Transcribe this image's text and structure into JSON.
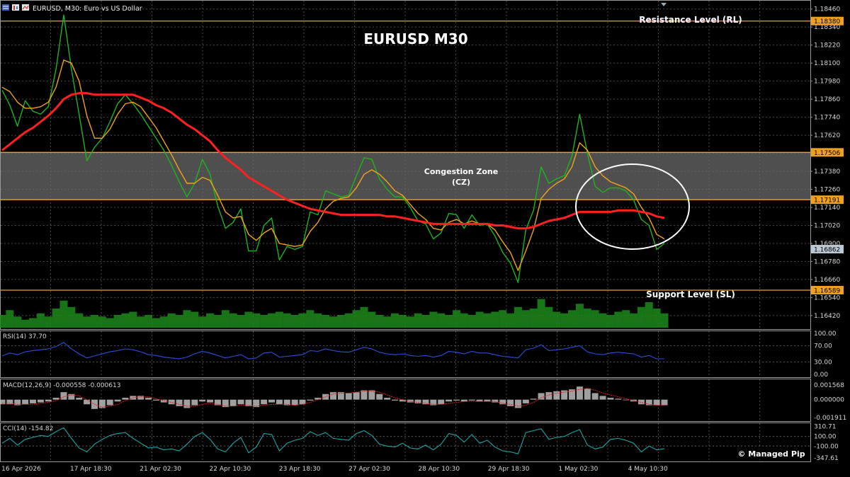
{
  "window": {
    "symbol_title": "EURUSD, M30:  Euro vs US Dollar",
    "watermark": "© Managed Pip"
  },
  "chart_data": [
    {
      "type": "line",
      "panel": "price",
      "title": "EURUSD M30",
      "ylim": [
        1.1633,
        1.1852
      ],
      "y_ticks": [
        "1.18460",
        "1.18340",
        "1.18220",
        "1.18100",
        "1.17980",
        "1.17860",
        "1.17740",
        "1.17620",
        "1.17500",
        "1.17380",
        "1.17260",
        "1.17140",
        "1.17020",
        "1.16900",
        "1.16780",
        "1.16660",
        "1.16540",
        "1.16420"
      ],
      "x_ticks": [
        "16 Apr 2026",
        "17 Apr 18:30",
        "21 Apr 02:30",
        "22 Apr 10:30",
        "23 Apr 18:30",
        "27 Apr 02:30",
        "28 Apr 10:30",
        "29 Apr 18:30",
        "1 May 02:30",
        "4 May 10:30"
      ],
      "levels": [
        {
          "label": "Resistance Level (RL)",
          "value": 1.1838,
          "tag": "1.18380"
        },
        {
          "label": "Support Level (SL)",
          "value": 1.16589,
          "tag": "1.16589"
        }
      ],
      "zone": {
        "label": "Congestion Zone\n(CZ)",
        "top": 1.17506,
        "bottom": 1.17191,
        "top_tag": "1.17506",
        "bottom_tag": "1.17191"
      },
      "current_price": {
        "value": 1.16862,
        "tag": "1.16862"
      },
      "series": [
        {
          "role": "price",
          "color": "#1db51d",
          "values": [
            1.1792,
            1.1782,
            1.1768,
            1.1785,
            1.1778,
            1.1776,
            1.1781,
            1.1806,
            1.1842,
            1.1806,
            1.1776,
            1.1745,
            1.1754,
            1.176,
            1.1771,
            1.1783,
            1.1789,
            1.1783,
            1.1776,
            1.1768,
            1.176,
            1.1752,
            1.1742,
            1.1731,
            1.1721,
            1.173,
            1.1746,
            1.1736,
            1.1715,
            1.17,
            1.1704,
            1.1713,
            1.1685,
            1.1685,
            1.1702,
            1.1707,
            1.1679,
            1.1688,
            1.1686,
            1.1688,
            1.1711,
            1.1709,
            1.1725,
            1.1723,
            1.1721,
            1.1722,
            1.1735,
            1.1747,
            1.1746,
            1.1733,
            1.1726,
            1.1721,
            1.1721,
            1.1714,
            1.1705,
            1.1703,
            1.1693,
            1.1697,
            1.171,
            1.1709,
            1.17,
            1.1709,
            1.1702,
            1.1703,
            1.1695,
            1.1684,
            1.1677,
            1.1664,
            1.1699,
            1.1712,
            1.1741,
            1.173,
            1.1733,
            1.1735,
            1.1748,
            1.1776,
            1.175,
            1.1728,
            1.1724,
            1.1727,
            1.1727,
            1.1725,
            1.1719,
            1.1706,
            1.1702,
            1.1686,
            1.169
          ]
        },
        {
          "role": "ma-fast",
          "color": "#f2a21a",
          "values": [
            1.1794,
            1.1791,
            1.1784,
            1.178,
            1.178,
            1.1781,
            1.1784,
            1.1794,
            1.1812,
            1.181,
            1.1798,
            1.1775,
            1.176,
            1.176,
            1.1766,
            1.1776,
            1.1783,
            1.1784,
            1.1781,
            1.1774,
            1.1767,
            1.1758,
            1.1749,
            1.1739,
            1.173,
            1.173,
            1.1734,
            1.1732,
            1.1722,
            1.1711,
            1.1707,
            1.1708,
            1.1696,
            1.1692,
            1.1697,
            1.17,
            1.169,
            1.1689,
            1.1688,
            1.1689,
            1.1698,
            1.1704,
            1.1713,
            1.1718,
            1.172,
            1.1721,
            1.1727,
            1.1736,
            1.1739,
            1.1736,
            1.1731,
            1.1725,
            1.1722,
            1.1716,
            1.171,
            1.1706,
            1.17,
            1.1699,
            1.1704,
            1.1706,
            1.1703,
            1.1705,
            1.1703,
            1.1703,
            1.1699,
            1.1691,
            1.1684,
            1.1672,
            1.1685,
            1.1699,
            1.172,
            1.1726,
            1.173,
            1.1733,
            1.1741,
            1.1757,
            1.1752,
            1.1741,
            1.1735,
            1.1731,
            1.1729,
            1.1727,
            1.1723,
            1.1714,
            1.1707,
            1.1696,
            1.1693
          ]
        },
        {
          "role": "ma-slow",
          "color": "#ff2020",
          "values": [
            1.1752,
            1.1756,
            1.176,
            1.1764,
            1.1767,
            1.1771,
            1.1775,
            1.178,
            1.1786,
            1.1789,
            1.179,
            1.179,
            1.1789,
            1.1789,
            1.1789,
            1.1789,
            1.1789,
            1.1789,
            1.1787,
            1.1785,
            1.1782,
            1.178,
            1.1777,
            1.1773,
            1.1769,
            1.1766,
            1.1762,
            1.1758,
            1.1752,
            1.1747,
            1.1743,
            1.1739,
            1.1734,
            1.1731,
            1.1728,
            1.1725,
            1.1722,
            1.1719,
            1.1717,
            1.1715,
            1.1713,
            1.1712,
            1.1711,
            1.171,
            1.1709,
            1.1709,
            1.1709,
            1.1709,
            1.1709,
            1.1709,
            1.1708,
            1.1708,
            1.1707,
            1.1706,
            1.1705,
            1.1704,
            1.1703,
            1.1703,
            1.1703,
            1.1703,
            1.1703,
            1.1703,
            1.1703,
            1.1703,
            1.1702,
            1.1702,
            1.1701,
            1.17,
            1.17,
            1.1701,
            1.1703,
            1.1705,
            1.1706,
            1.1707,
            1.1709,
            1.1711,
            1.1711,
            1.1711,
            1.1711,
            1.1711,
            1.1712,
            1.1712,
            1.1712,
            1.1711,
            1.171,
            1.1708,
            1.1707
          ]
        }
      ]
    },
    {
      "type": "bar",
      "panel": "volume",
      "color": "#1b8a1b",
      "values": [
        0.4,
        0.55,
        0.35,
        0.25,
        0.3,
        0.45,
        0.35,
        0.6,
        0.85,
        0.65,
        0.45,
        0.35,
        0.4,
        0.35,
        0.3,
        0.4,
        0.45,
        0.5,
        0.35,
        0.4,
        0.3,
        0.35,
        0.45,
        0.4,
        0.55,
        0.5,
        0.35,
        0.45,
        0.4,
        0.55,
        0.45,
        0.4,
        0.5,
        0.45,
        0.4,
        0.45,
        0.5,
        0.45,
        0.4,
        0.45,
        0.55,
        0.45,
        0.4,
        0.35,
        0.4,
        0.45,
        0.55,
        0.65,
        0.5,
        0.4,
        0.35,
        0.45,
        0.4,
        0.35,
        0.45,
        0.4,
        0.5,
        0.45,
        0.4,
        0.55,
        0.45,
        0.4,
        0.5,
        0.45,
        0.5,
        0.55,
        0.45,
        0.65,
        0.55,
        0.6,
        0.9,
        0.65,
        0.5,
        0.45,
        0.55,
        0.75,
        0.6,
        0.55,
        0.45,
        0.4,
        0.5,
        0.55,
        0.45,
        0.65,
        0.8,
        0.6,
        0.45
      ]
    },
    {
      "type": "line",
      "panel": "rsi",
      "label": "RSI(14) 37.70",
      "ylim": [
        0,
        100
      ],
      "y_ticks": [
        "100.00",
        "70.00",
        "30.00",
        "0.00"
      ],
      "levels": [
        70,
        30
      ],
      "series": [
        {
          "color": "#2b4fd6",
          "values": [
            45,
            52,
            48,
            55,
            58,
            60,
            62,
            68,
            78,
            62,
            50,
            40,
            45,
            50,
            55,
            58,
            62,
            60,
            55,
            48,
            46,
            42,
            40,
            38,
            42,
            50,
            56,
            52,
            46,
            40,
            44,
            48,
            38,
            40,
            52,
            54,
            42,
            44,
            46,
            48,
            58,
            56,
            62,
            58,
            55,
            54,
            60,
            66,
            62,
            54,
            50,
            48,
            50,
            46,
            44,
            46,
            42,
            46,
            56,
            54,
            50,
            56,
            52,
            52,
            48,
            44,
            42,
            40,
            60,
            64,
            72,
            58,
            60,
            62,
            66,
            70,
            55,
            50,
            48,
            52,
            54,
            52,
            50,
            42,
            46,
            38,
            38
          ]
        }
      ]
    },
    {
      "type": "bar",
      "panel": "macd",
      "label": "MACD(12,26,9) -0.000558 -0.000613",
      "ylim": [
        -0.002,
        0.00195
      ],
      "y_ticks": [
        "0.001568",
        "0.000000",
        "-0.001911"
      ],
      "series": [
        {
          "name": "histogram",
          "color": "#c8c8c8",
          "values": [
            -0.0005,
            -0.0005,
            -0.0006,
            -0.0005,
            -0.0004,
            -0.0003,
            -0.0002,
            0.0002,
            0.0008,
            0.0006,
            0.0002,
            -0.0005,
            -0.001,
            -0.0009,
            -0.0006,
            -0.0002,
            0.0002,
            0.0004,
            0.0004,
            0.0002,
            -0.0001,
            -0.0003,
            -0.0005,
            -0.0007,
            -0.0009,
            -0.0006,
            -0.0002,
            -0.0003,
            -0.0006,
            -0.0008,
            -0.0007,
            -0.0005,
            -0.0007,
            -0.0008,
            -0.0005,
            -0.0003,
            -0.0005,
            -0.0006,
            -0.0006,
            -0.0005,
            -0.0001,
            0.0002,
            0.0006,
            0.0008,
            0.0008,
            0.0007,
            0.0008,
            0.001,
            0.001,
            0.0006,
            0.0002,
            -0.0001,
            -0.0002,
            -0.0003,
            -0.0004,
            -0.0005,
            -0.0006,
            -0.0005,
            -0.0002,
            -0.0001,
            -0.0002,
            -0.0001,
            -0.0002,
            -0.0002,
            -0.0003,
            -0.0005,
            -0.0007,
            -0.0009,
            -0.0004,
            0.0001,
            0.0007,
            0.0008,
            0.0009,
            0.001,
            0.0011,
            0.0014,
            0.0012,
            0.0007,
            0.0004,
            0.0002,
            0.0001,
            0.0,
            -0.0002,
            -0.0005,
            -0.0006,
            -0.0006,
            -0.0006
          ]
        },
        {
          "name": "signal",
          "color": "#e02020",
          "values": [
            -0.0004,
            -0.0004,
            -0.0005,
            -0.0005,
            -0.0005,
            -0.0004,
            -0.0003,
            -0.0001,
            0.0003,
            0.0005,
            0.0004,
            0.0,
            -0.0005,
            -0.0008,
            -0.0007,
            -0.0005,
            -0.0001,
            0.0002,
            0.0003,
            0.0003,
            0.0001,
            -0.0001,
            -0.0003,
            -0.0005,
            -0.0007,
            -0.0007,
            -0.0005,
            -0.0004,
            -0.0005,
            -0.0007,
            -0.0007,
            -0.0006,
            -0.0006,
            -0.0007,
            -0.0006,
            -0.0005,
            -0.0005,
            -0.0005,
            -0.0006,
            -0.0005,
            -0.0003,
            0.0,
            0.0003,
            0.0006,
            0.0007,
            0.0007,
            0.0008,
            0.0009,
            0.0009,
            0.0008,
            0.0005,
            0.0002,
            0.0,
            -0.0002,
            -0.0003,
            -0.0004,
            -0.0005,
            -0.0005,
            -0.0004,
            -0.0003,
            -0.0002,
            -0.0002,
            -0.0002,
            -0.0002,
            -0.0002,
            -0.0004,
            -0.0005,
            -0.0007,
            -0.0006,
            -0.0003,
            0.0002,
            0.0005,
            0.0007,
            0.0008,
            0.0009,
            0.0011,
            0.0012,
            0.001,
            0.0007,
            0.0005,
            0.0003,
            0.0001,
            -0.0001,
            -0.0003,
            -0.0005,
            -0.0006,
            -0.0006
          ]
        }
      ]
    },
    {
      "type": "line",
      "panel": "cci",
      "label": "CCI(14) -154.82",
      "ylim": [
        -360,
        330
      ],
      "y_ticks": [
        "310.71",
        "100.00",
        "-100.00",
        "-347.61"
      ],
      "levels": [
        100,
        -100
      ],
      "series": [
        {
          "color": "#1aa6a6",
          "values": [
            -40,
            60,
            -80,
            40,
            80,
            120,
            100,
            200,
            280,
            60,
            -140,
            -220,
            -60,
            40,
            120,
            160,
            180,
            60,
            -40,
            -140,
            -120,
            -180,
            -160,
            -200,
            -60,
            100,
            180,
            40,
            -160,
            -220,
            -40,
            80,
            -240,
            -120,
            160,
            140,
            -200,
            -40,
            20,
            60,
            200,
            120,
            180,
            60,
            40,
            20,
            160,
            220,
            120,
            -60,
            -100,
            -120,
            -40,
            -140,
            -160,
            -80,
            -180,
            -60,
            160,
            120,
            -20,
            140,
            -40,
            20,
            -120,
            -200,
            -220,
            -260,
            180,
            220,
            260,
            40,
            80,
            100,
            180,
            240,
            -80,
            -160,
            -120,
            40,
            60,
            20,
            -40,
            -220,
            -100,
            -180,
            -155
          ]
        }
      ]
    }
  ]
}
